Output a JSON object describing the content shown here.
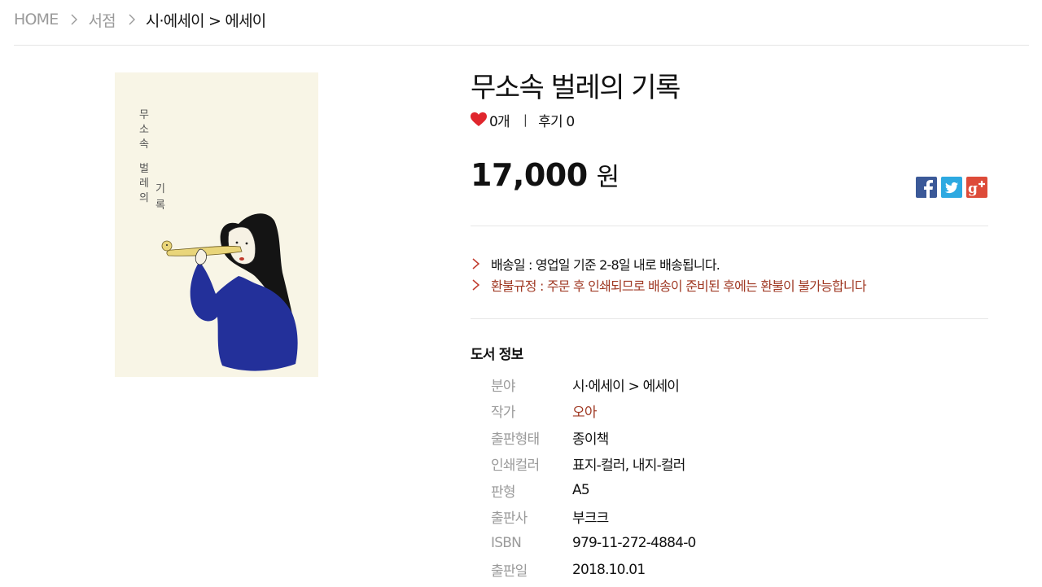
{
  "breadcrumb": {
    "home": "HOME",
    "shop": "서점",
    "category": "시·에세이 > 에세이"
  },
  "cover": {
    "title_chars": [
      "무",
      "소",
      "속",
      "벌",
      "레",
      "의",
      "기",
      "록"
    ],
    "background": "#f8f5e6",
    "accent": "#23309a"
  },
  "product": {
    "title": "무소속 벌레의 기록",
    "likes": "0개",
    "reviews": "후기 0",
    "price": "17,000",
    "currency": "원"
  },
  "share": {
    "facebook": {
      "icon": "facebook-icon",
      "color": "#3b5998"
    },
    "twitter": {
      "icon": "twitter-icon",
      "color": "#2da9e1"
    },
    "googleplus": {
      "icon": "google-plus-icon",
      "color": "#dd4b39"
    }
  },
  "shipping": {
    "delivery": "배송일 : 영업일 기준 2-8일 내로 배송됩니다.",
    "refund": "환불규정 : 주문 후 인쇄되므로 배송이 준비된 후에는 환불이 불가능합니다"
  },
  "book_info": {
    "heading": "도서 정보",
    "rows": [
      {
        "label": "분야",
        "value": "시·에세이 > 에세이"
      },
      {
        "label": "작가",
        "value": "오아"
      },
      {
        "label": "출판형태",
        "value": "종이책"
      },
      {
        "label": "인쇄컬러",
        "value": "표지-컬러, 내지-컬러"
      },
      {
        "label": "판형",
        "value": "A5"
      },
      {
        "label": "출판사",
        "value": "부크크"
      },
      {
        "label": "ISBN",
        "value": "979-11-272-4884-0"
      },
      {
        "label": "출판일",
        "value": "2018.10.01"
      }
    ]
  },
  "colors": {
    "heart": "#e0262d",
    "refund_text": "#a03a25",
    "muted_text": "#9a9a9a"
  }
}
